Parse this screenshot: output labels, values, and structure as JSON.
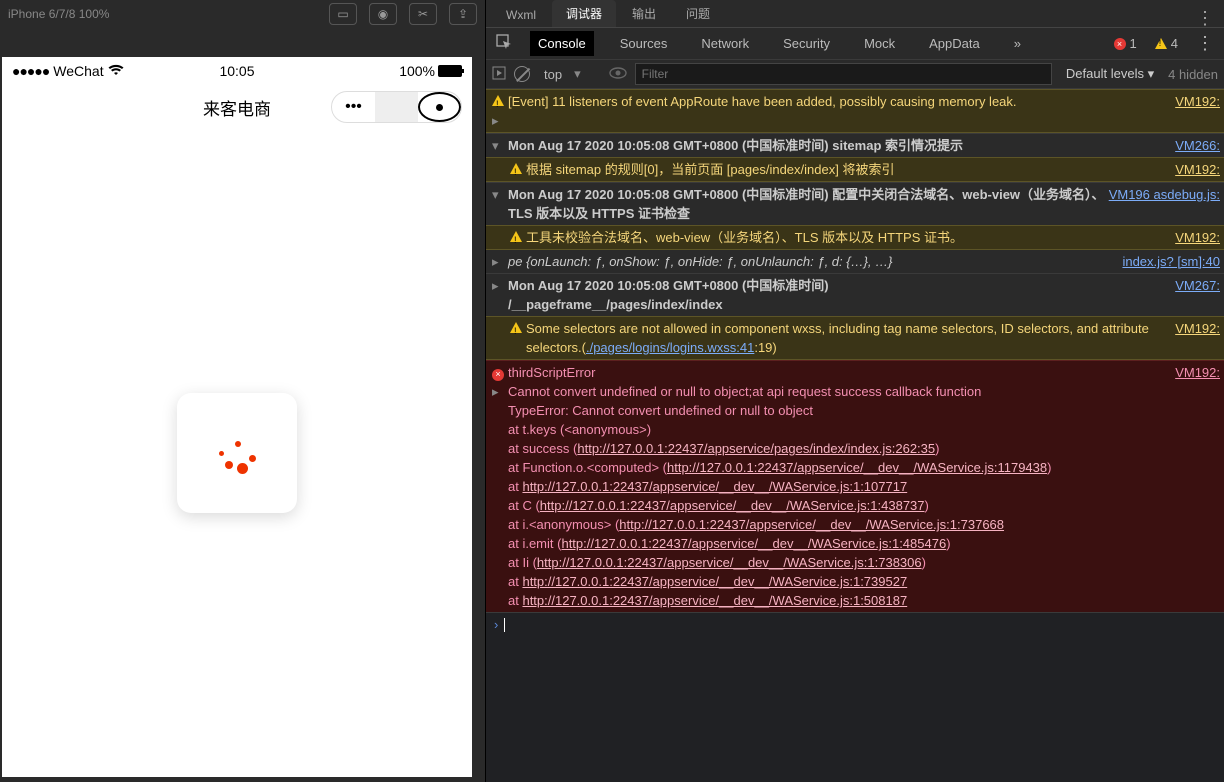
{
  "toolbar": {
    "device_label": "iPhone 6/7/8 100%"
  },
  "simulator": {
    "carrier": "WeChat",
    "time": "10:05",
    "battery": "100%",
    "title": "来客电商",
    "signal_dots": "●●●●●"
  },
  "tabs": {
    "wxml": "Wxml",
    "debugger": "调试器",
    "output": "输出",
    "issues": "问题"
  },
  "subtabs": {
    "console": "Console",
    "sources": "Sources",
    "network": "Network",
    "security": "Security",
    "mock": "Mock",
    "appdata": "AppData",
    "more": "»"
  },
  "counts": {
    "errors": "1",
    "warnings": "4"
  },
  "filter": {
    "scope": "top",
    "placeholder": "Filter",
    "levels": "Default levels ▾",
    "hidden": "4 hidden"
  },
  "logs": {
    "l1": {
      "msg": "[Event] 11 listeners of event AppRoute have been added, possibly causing memory leak.",
      "src": "VM192:"
    },
    "l2": {
      "msg": "Mon Aug 17 2020 10:05:08 GMT+0800 (中国标准时间) sitemap 索引情况提示",
      "src": "VM266:"
    },
    "l3": {
      "msg": "根据 sitemap 的规则[0]，当前页面 [pages/index/index] 将被索引",
      "src": "VM192:"
    },
    "l4": {
      "msg": "Mon Aug 17 2020 10:05:08 GMT+0800 (中国标准时间) 配置中关闭合法域名、web-view（业务域名）、TLS 版本以及 HTTPS 证书检查",
      "src": "VM196 asdebug.js:"
    },
    "l5": {
      "msg": "工具未校验合法域名、web-view（业务域名）、TLS 版本以及 HTTPS 证书。",
      "src": "VM192:"
    },
    "l6": {
      "msg": "pe {onLaunch: ƒ, onShow: ƒ, onHide: ƒ, onUnlaunch: ƒ, d: {…}, …}",
      "src": "index.js? [sm]:40"
    },
    "l7": {
      "msg1": "Mon Aug 17 2020 10:05:08 GMT+0800 (中国标准时间)",
      "msg2": "/__pageframe__/pages/index/index",
      "src": "VM267:"
    },
    "l8": {
      "msg_a": "Some selectors are not allowed in component wxss, including tag name selectors, ID selectors, and attribute selectors.(",
      "link": "./pages/logins/logins.wxss:41",
      "msg_b": ":19)",
      "src": "VM192:"
    },
    "err": {
      "title": "thirdScriptError",
      "src": "VM192:",
      "line1": "Cannot convert undefined or null to object;at api request success callback function",
      "line2": "TypeError: Cannot convert undefined or null to object",
      "line3": "    at t.keys (<anonymous>)",
      "line4a": "    at success (",
      "line4l": "http://127.0.0.1:22437/appservice/pages/index/index.js:262:35",
      "line4b": ")",
      "line5a": "    at Function.o.<computed> (",
      "line5l": "http://127.0.0.1:22437/appservice/__dev__/WAService.js:1179438",
      "line5b": ")",
      "line6a": "    at ",
      "line6l": "http://127.0.0.1:22437/appservice/__dev__/WAService.js:1:107717",
      "line7a": "    at C (",
      "line7l": "http://127.0.0.1:22437/appservice/__dev__/WAService.js:1:438737",
      "line7b": ")",
      "line8a": "    at i.<anonymous> (",
      "line8l": "http://127.0.0.1:22437/appservice/__dev__/WAService.js:1:737668",
      "line9a": "    at i.emit (",
      "line9l": "http://127.0.0.1:22437/appservice/__dev__/WAService.js:1:485476",
      "line9b": ")",
      "line10a": "    at Ii (",
      "line10l": "http://127.0.0.1:22437/appservice/__dev__/WAService.js:1:738306",
      "line10b": ")",
      "line11a": "    at ",
      "line11l": "http://127.0.0.1:22437/appservice/__dev__/WAService.js:1:739527",
      "line12a": "    at ",
      "line12l": "http://127.0.0.1:22437/appservice/__dev__/WAService.js:1:508187"
    }
  },
  "prompt": "›"
}
